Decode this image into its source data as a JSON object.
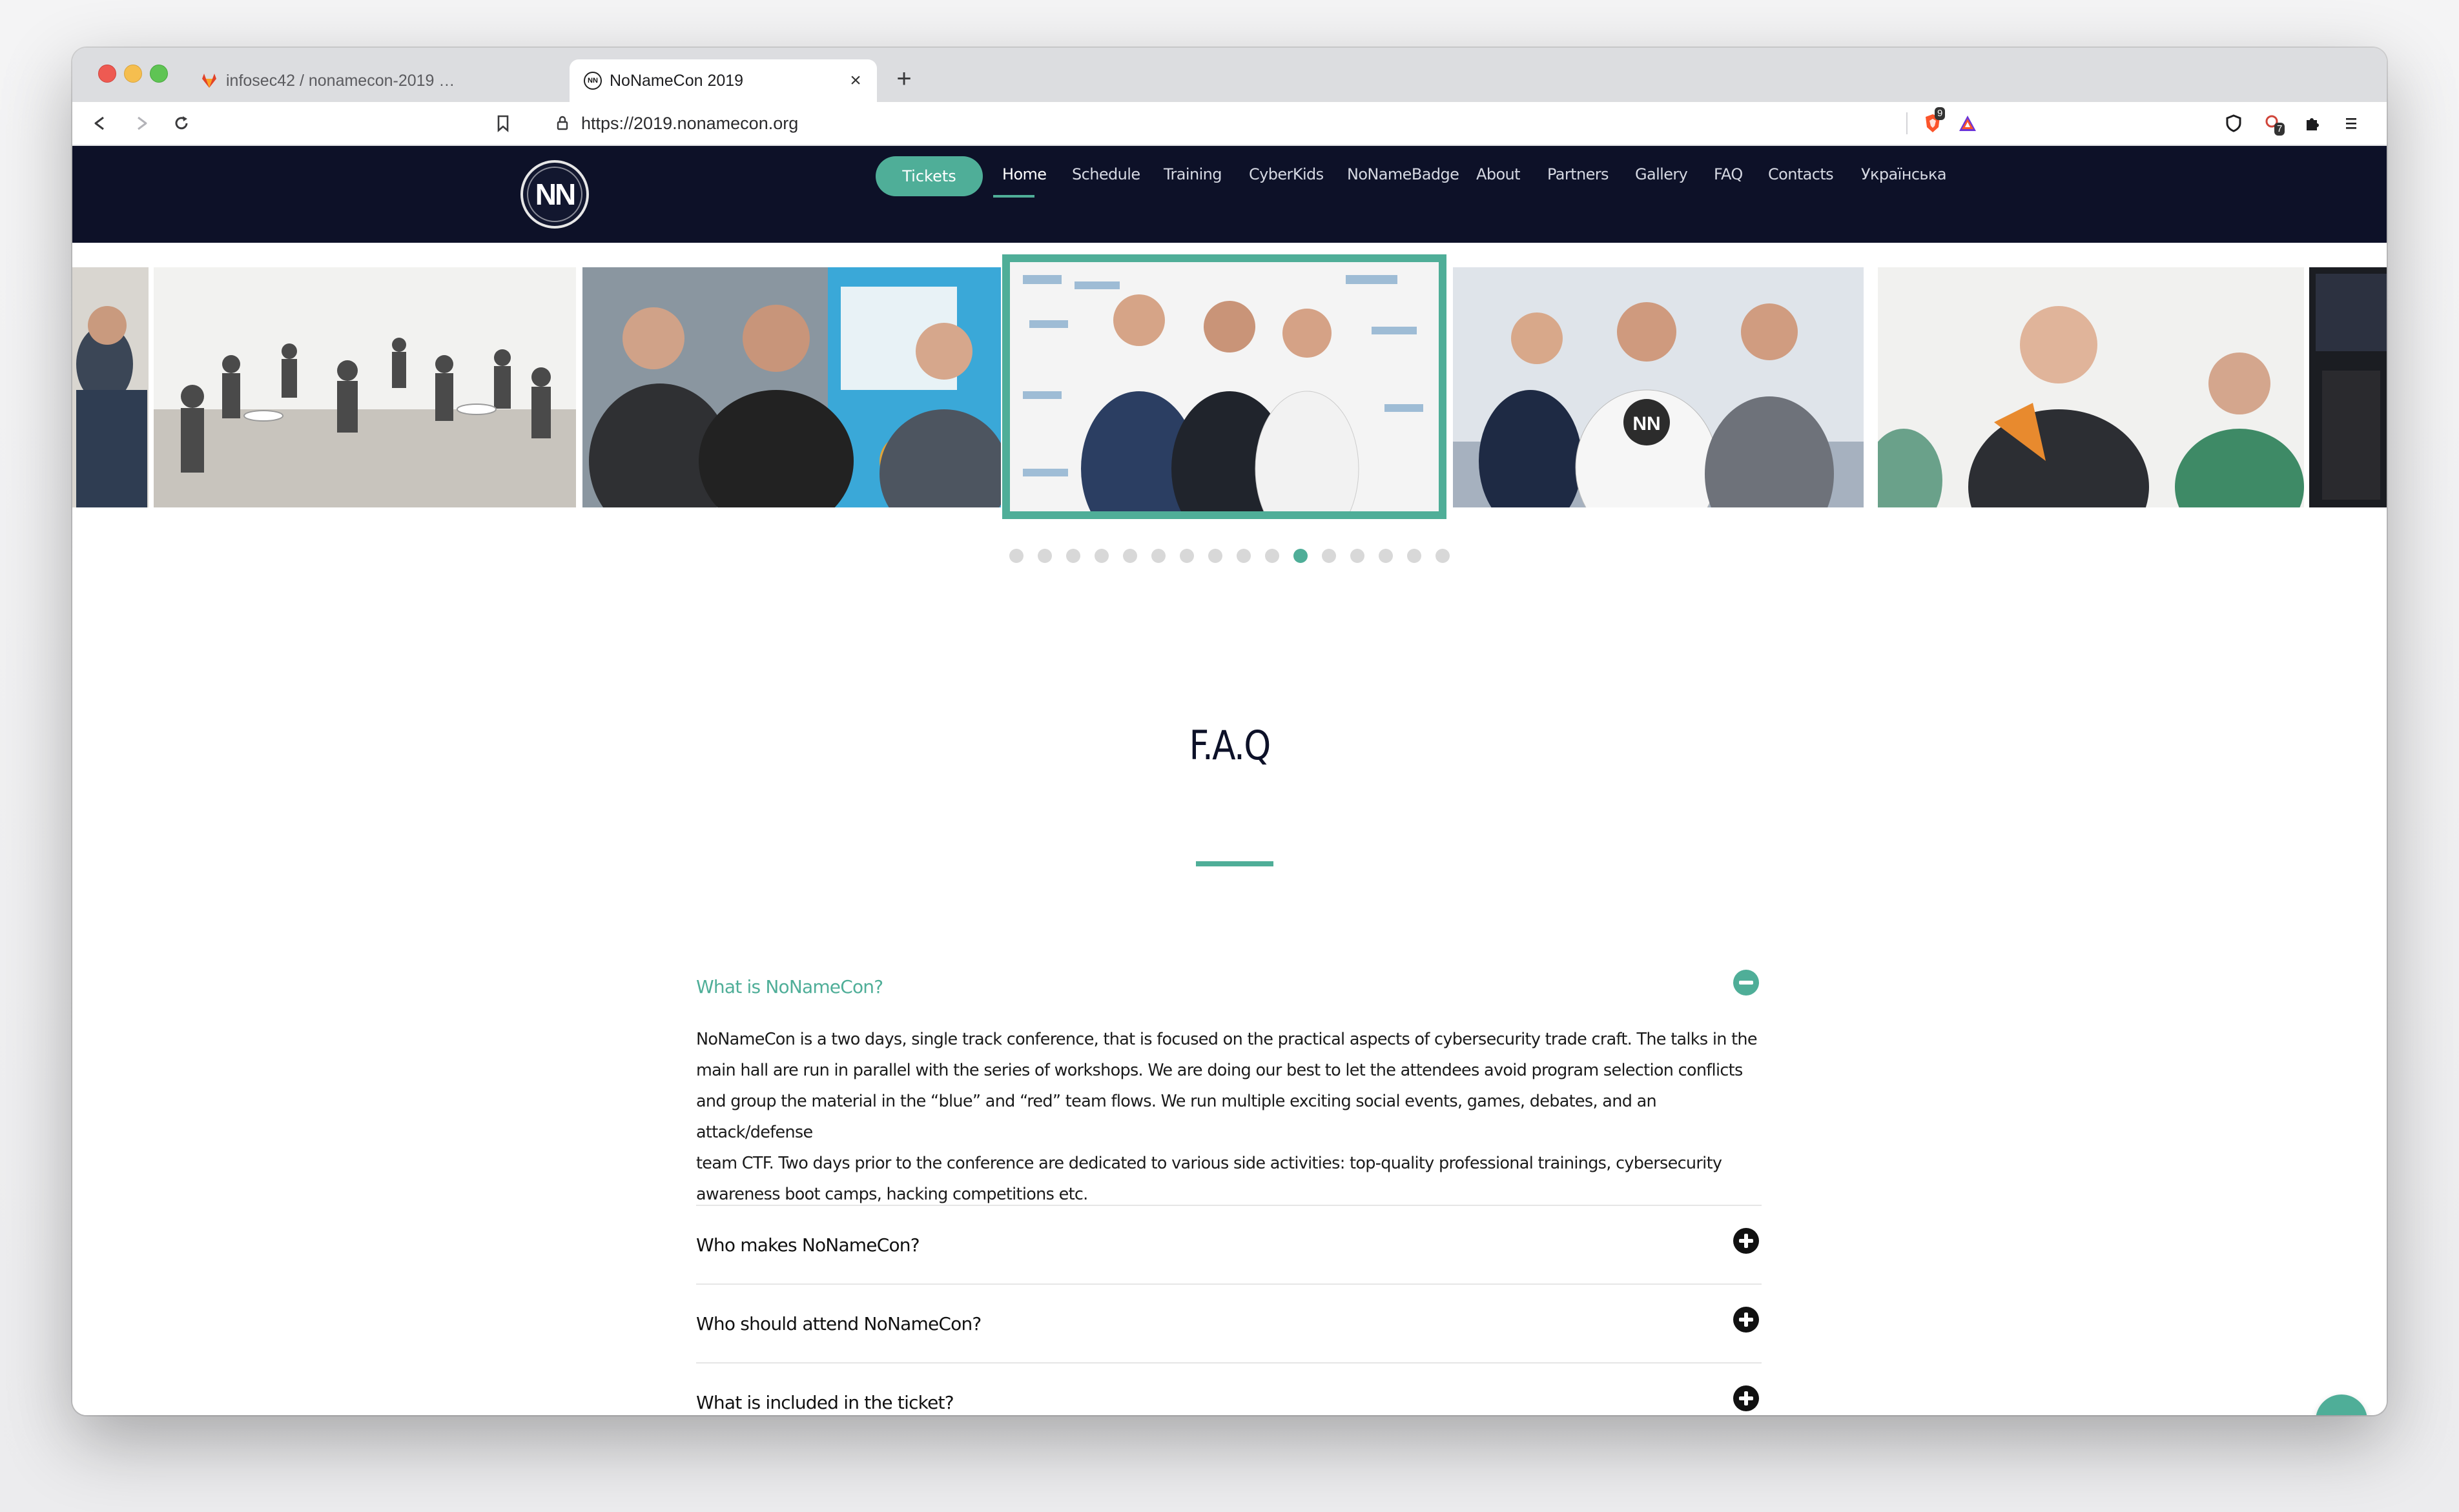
{
  "browser": {
    "tabs": [
      {
        "label": "infosec42 / nonamecon-2019 · GitLab",
        "icon": "gitlab-icon",
        "active": false
      },
      {
        "label": "NoNameCon 2019",
        "icon": "nn-favicon-icon",
        "active": true
      }
    ],
    "url": "https://2019.nonamecon.org",
    "extension_badges": {
      "brave_shields": "9",
      "extension_count": "7"
    }
  },
  "site": {
    "logo_text": "NN",
    "tickets_label": "Tickets",
    "nav": [
      {
        "label": "Home",
        "active": true
      },
      {
        "label": "Schedule",
        "active": false
      },
      {
        "label": "Training",
        "active": false
      },
      {
        "label": "CyberKids",
        "active": false
      },
      {
        "label": "NoNameBadge",
        "active": false
      },
      {
        "label": "About",
        "active": false
      },
      {
        "label": "Partners",
        "active": false
      },
      {
        "label": "Gallery",
        "active": false
      },
      {
        "label": "FAQ",
        "active": false
      },
      {
        "label": "Contacts",
        "active": false
      },
      {
        "label": "Українська",
        "active": false
      }
    ]
  },
  "carousel": {
    "dot_count": 16,
    "current_dot": 10,
    "slide_badge_text": "NN"
  },
  "faq": {
    "title": "F.A.Q",
    "items": [
      {
        "question": "What is NoNameCon?",
        "open": true,
        "answer_lines": [
          "NoNameCon is a two days, single track conference, that is focused on the practical aspects of cybersecurity trade craft. The talks in the",
          "main hall are run in parallel with the series of workshops. We are doing our best to let the attendees avoid program selection conflicts",
          "and group the material in the “blue” and “red” team flows. We run multiple exciting social events, games, debates, and an attack/defense",
          "team CTF. Two days prior to the conference are dedicated to various side activities: top-quality professional trainings, cybersecurity",
          "awareness boot camps, hacking competitions etc."
        ]
      },
      {
        "question": "Who makes NoNameCon?",
        "open": false
      },
      {
        "question": "Who should attend NoNameCon?",
        "open": false
      },
      {
        "question": "What is included in the ticket?",
        "open": false
      }
    ]
  },
  "colors": {
    "accent": "#4fae98",
    "nav_bg": "#0d1128",
    "title": "#0d1128"
  }
}
